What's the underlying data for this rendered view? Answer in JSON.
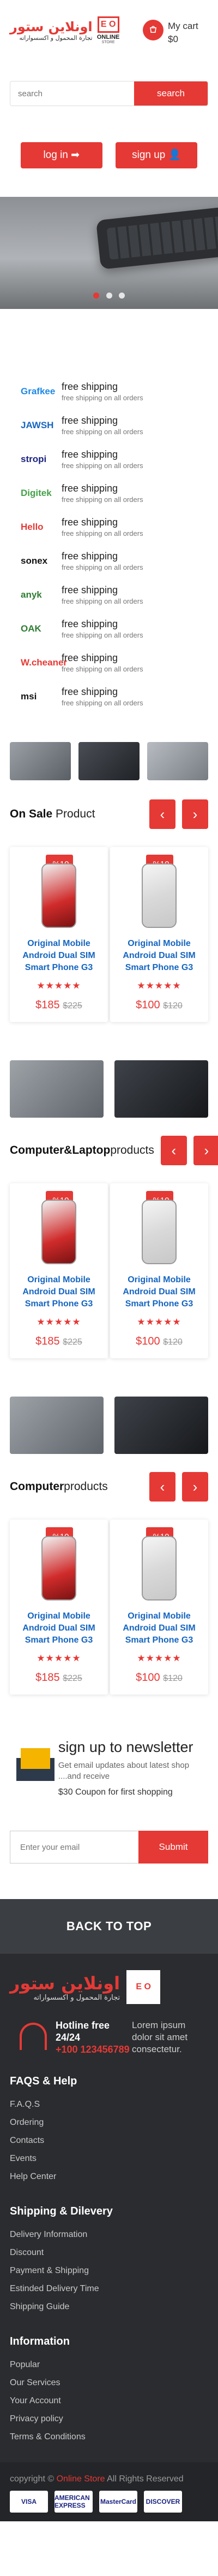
{
  "header": {
    "logo_arabic": "اونلاين ستور",
    "logo_tagline": "تجارة المحمول و اكسسواراته",
    "logo_mark": "E O",
    "logo_online": "ONLINE",
    "logo_store": "STORE",
    "cart_label": "My cart",
    "cart_total": "$0",
    "search_placeholder": "search",
    "search_button": "search"
  },
  "auth": {
    "login": "log in",
    "signup": "sign up"
  },
  "hero": {
    "dots": 3,
    "active_dot": 1
  },
  "brands": [
    {
      "name": "Grafkee",
      "color": "#1e88e5",
      "title": "free shipping",
      "subtitle": "free shipping on all orders"
    },
    {
      "name": "JAWSH",
      "color": "#1565c0",
      "title": "free shipping",
      "subtitle": "free shipping on all orders"
    },
    {
      "name": "stropi",
      "color": "#1a237e",
      "title": "free shipping",
      "subtitle": "free shipping on all orders"
    },
    {
      "name": "Digitek",
      "color": "#43a047",
      "title": "free shipping",
      "subtitle": "free shipping on all orders"
    },
    {
      "name": "Hello",
      "color": "#e53935",
      "title": "free shipping",
      "subtitle": "free shipping on all orders"
    },
    {
      "name": "sonex",
      "color": "#111111",
      "title": "free shipping",
      "subtitle": "free shipping on all orders"
    },
    {
      "name": "anyk",
      "color": "#2e7d32",
      "title": "free shipping",
      "subtitle": "free shipping on all orders"
    },
    {
      "name": "OAK",
      "color": "#2e7d32",
      "title": "free shipping",
      "subtitle": "free shipping on all orders"
    },
    {
      "name": "W.cheaner",
      "color": "#e53935",
      "title": "free shipping",
      "subtitle": "free shipping on all orders"
    },
    {
      "name": "msi",
      "color": "#111111",
      "title": "free shipping",
      "subtitle": "free shipping on all orders"
    }
  ],
  "sections": [
    {
      "title_bold": "On Sale",
      "title_rest": " Product",
      "products": [
        {
          "badge": "-%10",
          "name": "Original Mobile Android Dual SIM Smart Phone G3",
          "stars": "★★★★★",
          "price": "$185",
          "old": "$225",
          "color": "red"
        },
        {
          "badge": "-%10",
          "name": "Original Mobile Android Dual SIM Smart Phone G3",
          "stars": "★★★★★",
          "price": "$100",
          "old": "$120",
          "color": "silver"
        }
      ]
    },
    {
      "title_bold": "Computer&Laptop",
      "title_rest": "products",
      "products": [
        {
          "badge": "-%10",
          "name": "Original Mobile Android Dual SIM Smart Phone G3",
          "stars": "★★★★★",
          "price": "$185",
          "old": "$225",
          "color": "red"
        },
        {
          "badge": "-%10",
          "name": "Original Mobile Android Dual SIM Smart Phone G3",
          "stars": "★★★★★",
          "price": "$100",
          "old": "$120",
          "color": "silver"
        }
      ]
    },
    {
      "title_bold": "Computer",
      "title_rest": "products",
      "products": [
        {
          "badge": "-%10",
          "name": "Original Mobile Android Dual SIM Smart Phone G3",
          "stars": "★★★★★",
          "price": "$185",
          "old": "$225",
          "color": "red"
        },
        {
          "badge": "-%10",
          "name": "Original Mobile Android Dual SIM Smart Phone G3",
          "stars": "★★★★★",
          "price": "$100",
          "old": "$120",
          "color": "silver"
        }
      ]
    }
  ],
  "newsletter": {
    "heading": "sign up to newsletter",
    "text": "Get email updates about latest shop ....and receive",
    "coupon": "$30 Coupon for first shopping",
    "placeholder": "Enter your email",
    "button": "Submit"
  },
  "footer": {
    "back_to_top": "BACK TO TOP",
    "logo_arabic": "اونلاين ستور",
    "logo_tagline": "تجارة المحمول و اكسسواراته",
    "hotline_label": "Hotline free 24/24",
    "hotline_number": "+100 123456789",
    "lorem": "Lorem ipsum dolor sit amet consectetur.",
    "groups": [
      {
        "title": "FAQS & Help",
        "links": [
          "F.A.Q.S",
          "Ordering",
          "Contacts",
          "Events",
          "Help Center"
        ]
      },
      {
        "title": "Shipping & Dilevery",
        "links": [
          "Delivery Information",
          "Discount",
          "Payment & Shipping",
          "Estinded Delivery Time",
          "Shipping Guide"
        ]
      },
      {
        "title": "Information",
        "links": [
          "Popular",
          "Our Services",
          "Your Account",
          "Privacy policy",
          "Terms & Conditions"
        ]
      }
    ],
    "copyright_pre": "copyright © ",
    "copyright_brand": "Online Store",
    "copyright_post": " All Rights Reserved",
    "payments": [
      "VISA",
      "AMERICAN EXPRESS",
      "MasterCard",
      "DISCOVER"
    ]
  }
}
